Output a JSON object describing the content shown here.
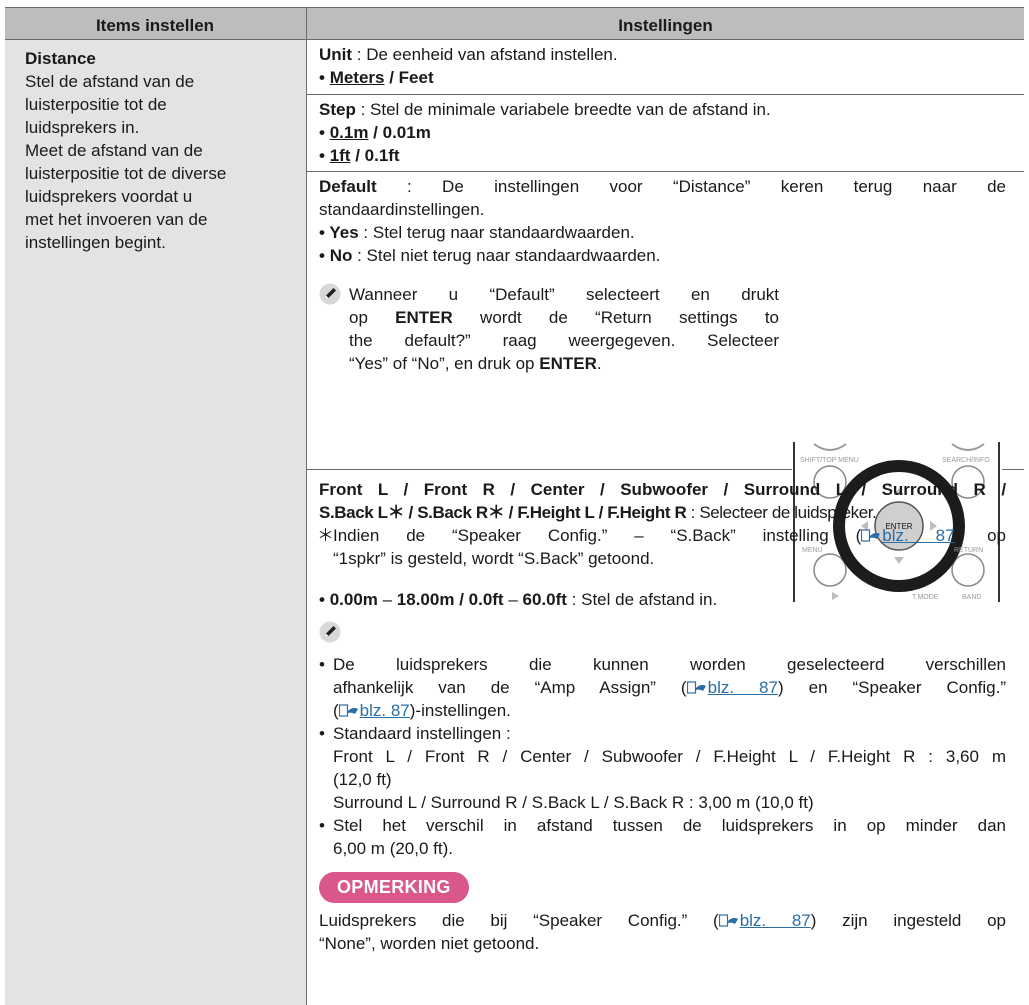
{
  "header": {
    "col1": "Items instellen",
    "col2": "Instellingen"
  },
  "left": {
    "title": "Distance",
    "lines": [
      "Stel de afstand van de",
      "luisterpositie tot de",
      "luidsprekers in.",
      "Meet de afstand van de",
      "luisterpositie tot de diverse",
      "luidsprekers voordat u",
      "met het invoeren van de",
      "instellingen begint."
    ]
  },
  "unit": {
    "label": "Unit",
    "desc": " : De eenheid van afstand instellen.",
    "opt1": "Meters",
    "sep": " / ",
    "opt2": "Feet"
  },
  "step": {
    "label": "Step",
    "desc": " : Stel de minimale variabele breedte van de afstand in.",
    "m1": "0.1m",
    "m2": "0.01m",
    "f1": "1ft",
    "f2": "0.1ft"
  },
  "default": {
    "label": "Default",
    "desc1": " : De instellingen voor “Distance” keren terug naar de",
    "desc2": "standaardinstellingen.",
    "yes": "Yes",
    "yes_desc": " : Stel terug naar standaardwaarden.",
    "no": "No",
    "no_desc": " : Stel niet terug naar standaardwaarden.",
    "note_a": "Wanneer u “Default” selecteert en drukt",
    "note_b1": "op ",
    "note_b_enter": "ENTER",
    "note_b2": " wordt de “Return settings to",
    "note_c": "the default?” raag weergegeven. Selecteer",
    "note_d1": "“Yes” of “No”, en druk op ",
    "note_d_enter": "ENTER",
    "note_d2": ".",
    "remote": {
      "shift_top_menu": "SHIFT/TOP MENU",
      "search_info": "SEARCH/INFO",
      "enter": "ENTER",
      "menu": "MENU",
      "return": "RETURN",
      "tmode": "T.MODE",
      "band": "BAND"
    }
  },
  "speakers": {
    "line1": [
      "Front L",
      "Front R",
      "Center",
      "Subwoofer",
      "Surround L",
      "Surround R"
    ],
    "line2": [
      "S.Back L",
      "S.Back R",
      "F.Height L",
      "F.Height R"
    ],
    "select_text": " : Selecteer de luidspreker.",
    "star": "＊",
    "foot1a": "Indien de “Speaker Config.” – “S.Back” instelling (",
    "foot1_link": "blz. 87",
    "foot1b": ") op",
    "foot2": "“1spkr” is gesteld, wordt “S.Back” getoond.",
    "range_a": "0.00m",
    "range_dash": " – ",
    "range_b": "18.00m",
    "range_sep": " / ",
    "range_c": "0.0ft",
    "range_d": "60.0ft",
    "range_desc": " : Stel de afstand in.",
    "n1a": "De luidsprekers die kunnen worden geselecteerd verschillen",
    "n1b_1": "afhankelijk van de “Amp Assign” (",
    "n1b_link": "blz. 87",
    "n1b_2": ") en “Speaker Config.”",
    "n1c_1": "(",
    "n1c_link": "blz. 87",
    "n1c_2": ")-instellingen.",
    "n2": "Standaard instellingen :",
    "n2a": "Front L / Front R / Center / Subwoofer / F.Height L / F.Height R : 3,60 m",
    "n2b": "(12,0 ft)",
    "n2c": "Surround L / Surround R / S.Back L / S.Back R : 3,00 m (10,0 ft)",
    "n3a": "Stel het verschil in afstand tussen de luidsprekers in op minder dan",
    "n3b": "6,00 m (20,0 ft).",
    "opm": "OPMERKING",
    "opm1a": "Luidsprekers die bij “Speaker Config.” (",
    "opm1_link": "blz. 87",
    "opm1b": ") zijn ingesteld op",
    "opm2": "“None”, worden niet getoond."
  },
  "colors": {
    "header_bg": "#bdbdbd",
    "left_bg": "#e3e3e3",
    "badge": "#d9578a",
    "link": "#2a6ea8"
  }
}
